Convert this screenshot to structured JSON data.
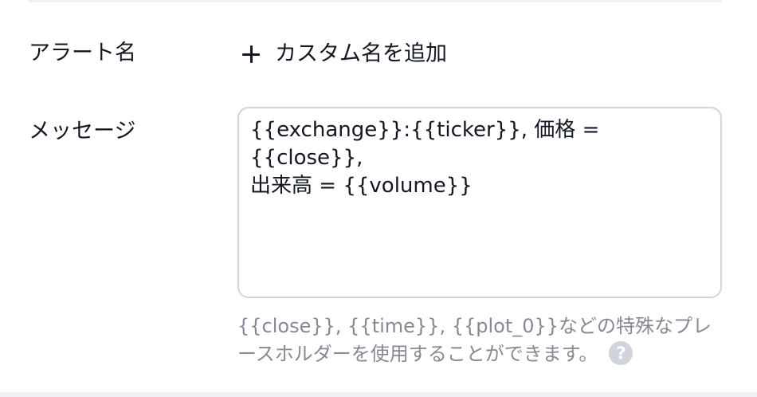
{
  "form": {
    "alert_name_label": "アラート名",
    "add_custom_name_label": "カスタム名を追加",
    "message_label": "メッセージ",
    "message_value": "{{exchange}}:{{ticker}}, 価格 = {{close}},\n出来高 = {{volume}}",
    "hint_text": "{{close}}, {{time}}, {{plot_0}}などの特殊なプレースホルダーを使用することができます。",
    "help_icon_glyph": "?"
  },
  "icons": {
    "add": "plus-icon",
    "help": "question-circle-icon"
  },
  "colors": {
    "text_primary": "#131722",
    "text_secondary": "#868993",
    "border": "#d1d4dc",
    "divider": "#f0f1f4",
    "help_icon_bg": "#d1d4dc"
  }
}
